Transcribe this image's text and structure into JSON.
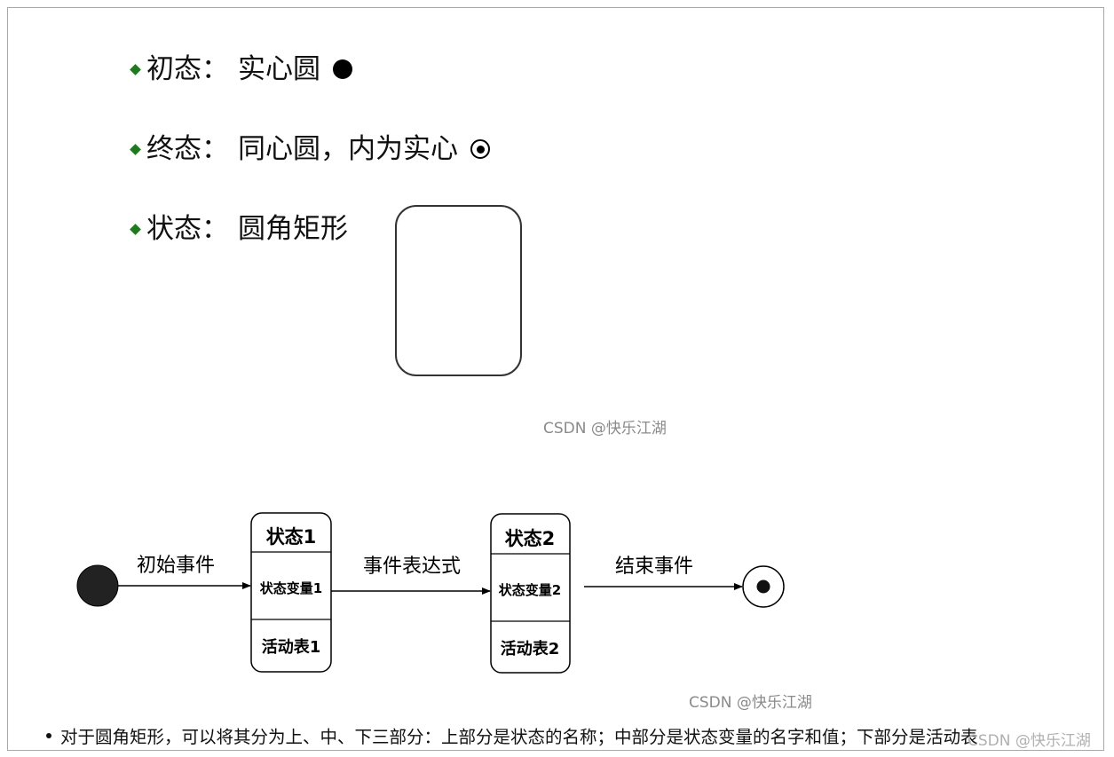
{
  "legend": {
    "separator": "：",
    "items": [
      {
        "term": "初态",
        "desc": "实心圆",
        "symbol": "filled-circle"
      },
      {
        "term": "终态",
        "desc": "同心圆，内为实心",
        "symbol": "bullseye"
      },
      {
        "term": "状态",
        "desc": "圆角矩形",
        "symbol": "rounded-rectangle"
      }
    ],
    "bullet_color": "#1f7a1f"
  },
  "watermark": "CSDN @快乐江湖",
  "diagram": {
    "start_event": "初始事件",
    "transition": "事件表达式",
    "end_event": "结束事件",
    "states": [
      {
        "name": "状态1",
        "variables": "状态变量1",
        "activities": "活动表1"
      },
      {
        "name": "状态2",
        "variables": "状态变量2",
        "activities": "活动表2"
      }
    ]
  },
  "footer": {
    "text": "对于圆角矩形，可以将其分为上、中、下三部分：上部分是状态的名称；中部分是状态变量的名字和值；下部分是活动表"
  }
}
